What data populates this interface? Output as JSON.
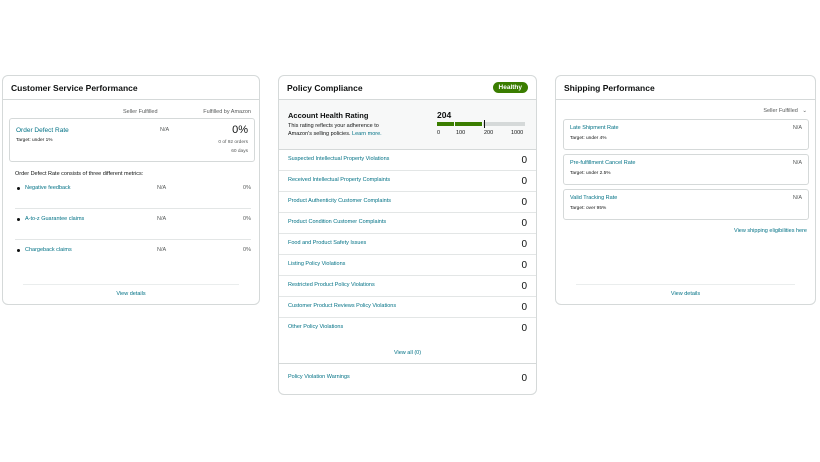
{
  "customer_service": {
    "title": "Customer Service Performance",
    "col_seller": "Seller Fulfilled",
    "col_amazon": "Fulfilled by Amazon",
    "odr": {
      "label": "Order Defect Rate",
      "target": "Target: under 1%",
      "seller_value": "N/A",
      "amazon_value": "0%",
      "orders": "0 of 92 orders",
      "period": "60 days"
    },
    "metrics_intro": "Order Defect Rate consists of three different metrics:",
    "metrics": [
      {
        "label": "Negative feedback",
        "seller": "N/A",
        "amazon": "0%"
      },
      {
        "label": "A-to-z Guarantee claims",
        "seller": "N/A",
        "amazon": "0%"
      },
      {
        "label": "Chargeback claims",
        "seller": "N/A",
        "amazon": "0%"
      }
    ],
    "footer_link": "View details"
  },
  "policy": {
    "title": "Policy Compliance",
    "badge": "Healthy",
    "ahr": {
      "title": "Account Health Rating",
      "desc_line1": "This rating reflects your adherence to",
      "desc_line2": "Amazon's selling policies.",
      "learn_more": "Learn more.",
      "score": "204",
      "score_value": 204,
      "ticks": [
        "0",
        "100",
        "200",
        "1000"
      ],
      "colors": {
        "good": "#3a7d00",
        "track": "#d5d9d9"
      }
    },
    "rows": [
      {
        "label": "Suspected Intellectual Property Violations",
        "value": "0"
      },
      {
        "label": "Received Intellectual Property Complaints",
        "value": "0"
      },
      {
        "label": "Product Authenticity Customer Complaints",
        "value": "0"
      },
      {
        "label": "Product Condition Customer Complaints",
        "value": "0"
      },
      {
        "label": "Food and Product Safety Issues",
        "value": "0"
      },
      {
        "label": "Listing Policy Violations",
        "value": "0"
      },
      {
        "label": "Restricted Product Policy Violations",
        "value": "0"
      },
      {
        "label": "Customer Product Reviews Policy Violations",
        "value": "0"
      },
      {
        "label": "Other Policy Violations",
        "value": "0"
      }
    ],
    "view_all": "View all (0)",
    "warnings": {
      "label": "Policy Violation Warnings",
      "value": "0"
    }
  },
  "shipping": {
    "title": "Shipping Performance",
    "dropdown": "Seller Fulfilled",
    "metrics": [
      {
        "label": "Late Shipment Rate",
        "target": "Target: under 4%",
        "value": "N/A"
      },
      {
        "label": "Pre-fulfillment Cancel Rate",
        "target": "Target: under 2.5%",
        "value": "N/A"
      },
      {
        "label": "Valid Tracking Rate",
        "target": "Target: over 95%",
        "value": "N/A"
      }
    ],
    "eligibility_link": "View shipping eligibilities here",
    "footer_link": "View details"
  }
}
